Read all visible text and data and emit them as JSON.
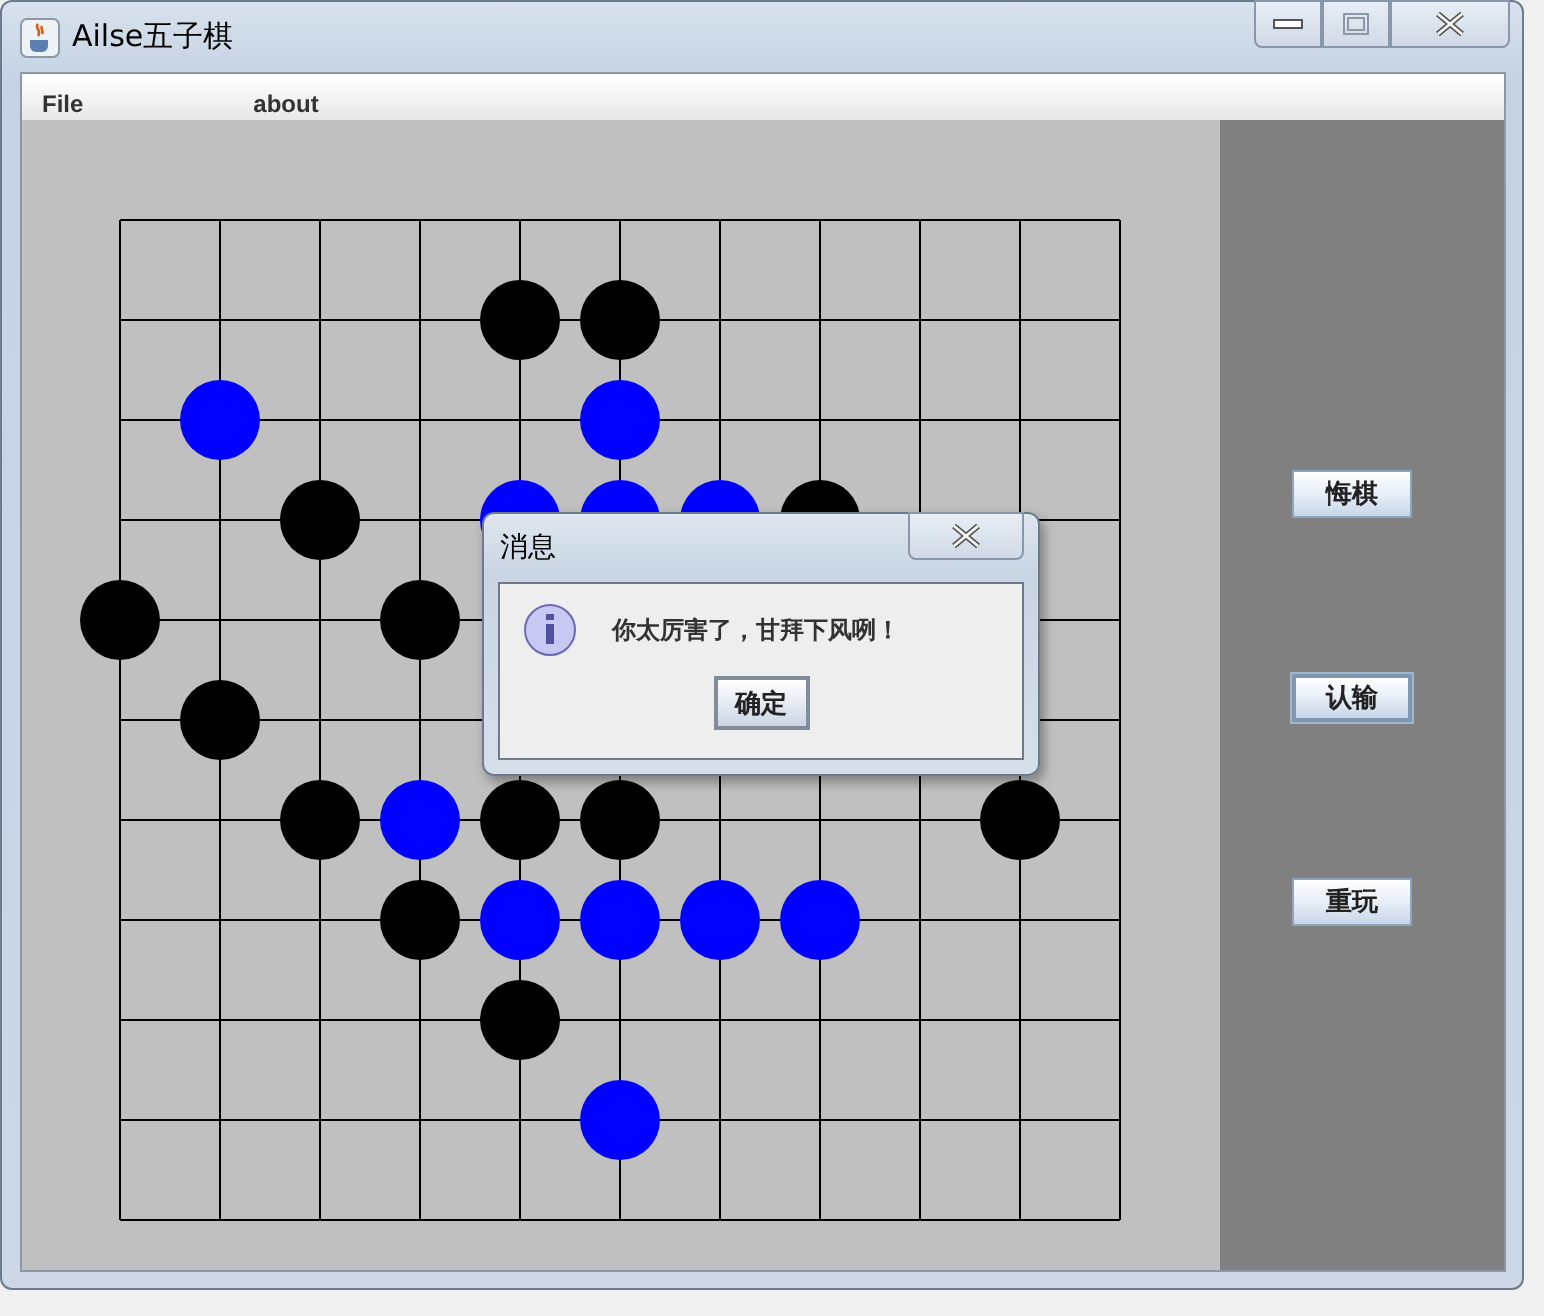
{
  "window": {
    "title": "Ailse五子棋"
  },
  "menu": [
    "File",
    "about"
  ],
  "board": {
    "rows": [
      [
        {
          "kind": "empty"
        },
        {
          "kind": "empty"
        },
        {
          "kind": "empty"
        },
        {
          "kind": "empty"
        },
        {
          "kind": "empty"
        },
        {
          "kind": "empty"
        },
        {
          "kind": "empty"
        },
        {
          "kind": "empty"
        },
        {
          "kind": "empty"
        },
        {
          "kind": "empty"
        },
        {
          "kind": "empty"
        }
      ],
      [
        {
          "kind": "empty"
        },
        {
          "kind": "empty"
        },
        {
          "kind": "empty"
        },
        {
          "kind": "empty"
        },
        {
          "kind": "stone",
          "color": "#000000"
        },
        {
          "kind": "stone",
          "color": "#000000"
        },
        {
          "kind": "empty"
        },
        {
          "kind": "empty"
        },
        {
          "kind": "empty"
        },
        {
          "kind": "empty"
        },
        {
          "kind": "empty"
        }
      ],
      [
        {
          "kind": "empty"
        },
        {
          "kind": "stone",
          "color": "#0000ff"
        },
        {
          "kind": "empty"
        },
        {
          "kind": "empty"
        },
        {
          "kind": "empty"
        },
        {
          "kind": "stone",
          "color": "#0000ff"
        },
        {
          "kind": "empty"
        },
        {
          "kind": "empty"
        },
        {
          "kind": "empty"
        },
        {
          "kind": "empty"
        },
        {
          "kind": "empty"
        }
      ],
      [
        {
          "kind": "empty"
        },
        {
          "kind": "empty"
        },
        {
          "kind": "stone",
          "color": "#000000"
        },
        {
          "kind": "empty"
        },
        {
          "kind": "stone",
          "color": "#0000ff"
        },
        {
          "kind": "stone",
          "color": "#0000ff"
        },
        {
          "kind": "stone",
          "color": "#0000ff"
        },
        {
          "kind": "stone",
          "color": "#000000"
        },
        {
          "kind": "empty"
        },
        {
          "kind": "empty"
        },
        {
          "kind": "empty"
        }
      ],
      [
        {
          "kind": "stone",
          "color": "#000000"
        },
        {
          "kind": "empty"
        },
        {
          "kind": "empty"
        },
        {
          "kind": "stone",
          "color": "#000000"
        },
        {
          "kind": "empty"
        },
        {
          "kind": "empty"
        },
        {
          "kind": "empty"
        },
        {
          "kind": "empty"
        },
        {
          "kind": "empty"
        },
        {
          "kind": "empty"
        },
        {
          "kind": "empty"
        }
      ],
      [
        {
          "kind": "empty"
        },
        {
          "kind": "stone",
          "color": "#000000"
        },
        {
          "kind": "empty"
        },
        {
          "kind": "empty"
        },
        {
          "kind": "empty"
        },
        {
          "kind": "empty"
        },
        {
          "kind": "empty"
        },
        {
          "kind": "empty"
        },
        {
          "kind": "empty"
        },
        {
          "kind": "empty"
        },
        {
          "kind": "empty"
        }
      ],
      [
        {
          "kind": "empty"
        },
        {
          "kind": "empty"
        },
        {
          "kind": "stone",
          "color": "#000000"
        },
        {
          "kind": "stone",
          "color": "#0000ff"
        },
        {
          "kind": "stone",
          "color": "#000000"
        },
        {
          "kind": "stone",
          "color": "#000000"
        },
        {
          "kind": "empty"
        },
        {
          "kind": "empty"
        },
        {
          "kind": "empty"
        },
        {
          "kind": "stone",
          "color": "#000000"
        },
        {
          "kind": "empty"
        }
      ],
      [
        {
          "kind": "empty"
        },
        {
          "kind": "empty"
        },
        {
          "kind": "empty"
        },
        {
          "kind": "stone",
          "color": "#000000"
        },
        {
          "kind": "stone",
          "color": "#0000ff"
        },
        {
          "kind": "stone",
          "color": "#0000ff"
        },
        {
          "kind": "stone",
          "color": "#0000ff"
        },
        {
          "kind": "stone",
          "color": "#0000ff"
        },
        {
          "kind": "empty"
        },
        {
          "kind": "empty"
        },
        {
          "kind": "empty"
        }
      ],
      [
        {
          "kind": "empty"
        },
        {
          "kind": "empty"
        },
        {
          "kind": "empty"
        },
        {
          "kind": "empty"
        },
        {
          "kind": "stone",
          "color": "#000000"
        },
        {
          "kind": "empty"
        },
        {
          "kind": "empty"
        },
        {
          "kind": "empty"
        },
        {
          "kind": "empty"
        },
        {
          "kind": "empty"
        },
        {
          "kind": "empty"
        }
      ],
      [
        {
          "kind": "empty"
        },
        {
          "kind": "empty"
        },
        {
          "kind": "empty"
        },
        {
          "kind": "empty"
        },
        {
          "kind": "empty"
        },
        {
          "kind": "stone",
          "color": "#0000ff"
        },
        {
          "kind": "empty"
        },
        {
          "kind": "empty"
        },
        {
          "kind": "empty"
        },
        {
          "kind": "empty"
        },
        {
          "kind": "empty"
        }
      ],
      [
        {
          "kind": "empty"
        },
        {
          "kind": "empty"
        },
        {
          "kind": "empty"
        },
        {
          "kind": "empty"
        },
        {
          "kind": "empty"
        },
        {
          "kind": "empty"
        },
        {
          "kind": "empty"
        },
        {
          "kind": "empty"
        },
        {
          "kind": "empty"
        },
        {
          "kind": "empty"
        },
        {
          "kind": "empty"
        }
      ]
    ]
  },
  "side_buttons": [
    {
      "label": "悔棋",
      "focused": false
    },
    {
      "label": "认输",
      "focused": true
    },
    {
      "label": "重玩",
      "focused": false
    }
  ],
  "dialog": {
    "title": "消息",
    "message": "你太厉害了，甘拜下风咧！",
    "button": {
      "label": "确定",
      "focused": true
    }
  }
}
